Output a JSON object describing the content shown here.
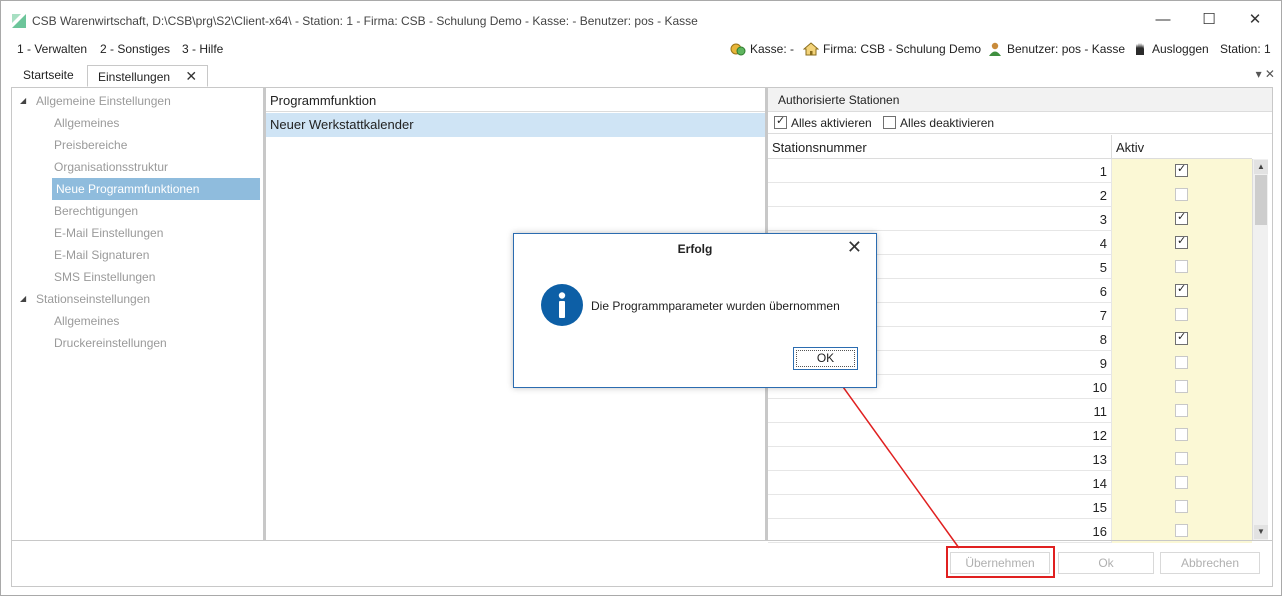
{
  "window": {
    "title": "CSB Warenwirtschaft, D:\\CSB\\prg\\S2\\Client-x64\\ - Station: 1 - Firma: CSB - Schulung Demo - Kasse:  - Benutzer: pos - Kasse",
    "minimize_glyph": "—",
    "maximize_glyph": "☐",
    "close_glyph": "✕"
  },
  "menu": {
    "items": [
      "1 - Verwalten",
      "2 - Sonstiges",
      "3 - Hilfe"
    ]
  },
  "status": {
    "kasse": "Kasse: -",
    "firma": "Firma: CSB - Schulung Demo",
    "benutzer": "Benutzer: pos - Kasse",
    "ausloggen": "Ausloggen",
    "station": "Station: 1"
  },
  "tabs": {
    "items": [
      "Startseite",
      "Einstellungen"
    ],
    "active": "Einstellungen",
    "close_glyph": "✕",
    "right_controls": "▾ ✕"
  },
  "tree": {
    "groups": [
      {
        "label": "Allgemeine Einstellungen",
        "toggle": "◢",
        "children": [
          "Allgemeines",
          "Preisbereiche",
          "Organisationsstruktur",
          "Neue Programmfunktionen",
          "Berechtigungen",
          "E-Mail Einstellungen",
          "E-Mail Signaturen",
          "SMS Einstellungen"
        ]
      },
      {
        "label": "Stationseinstellungen",
        "toggle": "◢",
        "children": [
          "Allgemeines",
          "Druckereinstellungen"
        ]
      }
    ],
    "selected": "Neue Programmfunktionen"
  },
  "functions": {
    "header": "Programmfunktion",
    "rows": [
      "Neuer Werkstattkalender"
    ]
  },
  "stations": {
    "title": "Authorisierte Stationen",
    "select_all": "Alles aktivieren",
    "select_all_checked": true,
    "deselect_all": "Alles deaktivieren",
    "deselect_all_checked": false,
    "columns": [
      "Stationsnummer",
      "Aktiv"
    ],
    "rows": [
      {
        "num": "1",
        "active": true
      },
      {
        "num": "2",
        "active": false
      },
      {
        "num": "3",
        "active": true
      },
      {
        "num": "4",
        "active": true
      },
      {
        "num": "5",
        "active": false
      },
      {
        "num": "6",
        "active": true
      },
      {
        "num": "7",
        "active": false
      },
      {
        "num": "8",
        "active": true
      },
      {
        "num": "9",
        "active": false
      },
      {
        "num": "10",
        "active": false
      },
      {
        "num": "11",
        "active": false
      },
      {
        "num": "12",
        "active": false
      },
      {
        "num": "13",
        "active": false
      },
      {
        "num": "14",
        "active": false
      },
      {
        "num": "15",
        "active": false
      },
      {
        "num": "16",
        "active": false
      }
    ],
    "scroll_up": "▲",
    "scroll_down": "▼"
  },
  "footer": {
    "apply": "Übernehmen",
    "ok": "Ok",
    "cancel": "Abbrechen"
  },
  "dialog": {
    "title": "Erfolg",
    "close_glyph": "✕",
    "message": "Die Programmparameter wurden übernommen",
    "ok": "OK"
  },
  "colors": {
    "selection": "#8fbcdd",
    "row_highlight": "#cfe4f5",
    "active_column": "#fbf8d5",
    "annotation": "#e02020",
    "info_blue": "#0d5fa6"
  }
}
